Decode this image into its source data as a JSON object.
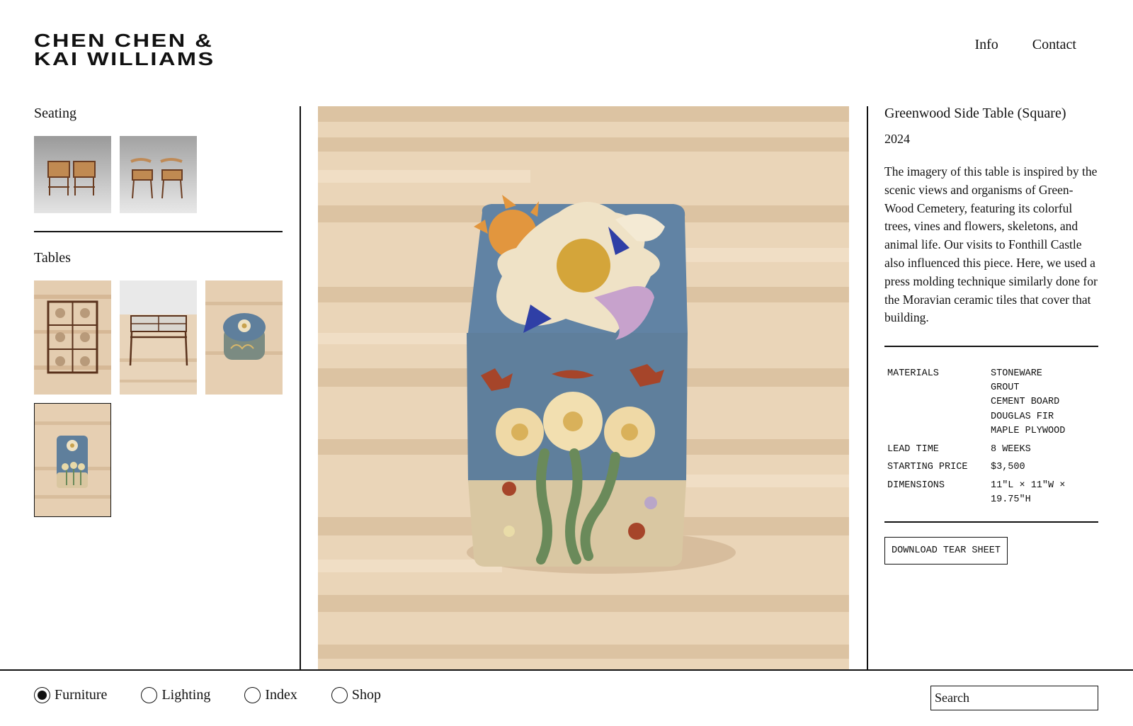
{
  "brand": {
    "line1": "CHEN CHEN &",
    "line2": "KAI WILLIAMS"
  },
  "topnav": {
    "info": "Info",
    "contact": "Contact"
  },
  "sidebar": {
    "seating_title": "Seating",
    "tables_title": "Tables"
  },
  "product": {
    "title": "Greenwood Side Table (Square)",
    "year": "2024",
    "description": "The imagery of this table is inspired by the scenic views and organisms of Green-Wood Cemetery, featuring its colorful trees, vines and flowers, skeletons, and animal life. Our visits to Fonthill Castle also influenced this piece. Here, we used a press molding technique similarly done for the Moravian ceramic tiles that cover that building.",
    "specs": {
      "materials_label": "MATERIALS",
      "materials": [
        "STONEWARE",
        "GROUT",
        "CEMENT BOARD",
        "DOUGLAS FIR",
        "MAPLE PLYWOOD"
      ],
      "lead_label": "LEAD TIME",
      "lead_value": "8 WEEKS",
      "price_label": "STARTING PRICE",
      "price_value": "$3,500",
      "dims_label": "DIMENSIONS",
      "dims_value": "11\"L × 11\"W × 19.75\"H"
    },
    "download_label": "DOWNLOAD TEAR SHEET"
  },
  "bottomnav": {
    "items": [
      {
        "label": "Furniture",
        "checked": true
      },
      {
        "label": "Lighting",
        "checked": false
      },
      {
        "label": "Index",
        "checked": false
      },
      {
        "label": "Shop",
        "checked": false
      }
    ],
    "search_placeholder": "Search"
  },
  "colors": {
    "wood": "#e6cfb1",
    "tile_blue": "#5f7f9c",
    "ink": "#111111"
  }
}
